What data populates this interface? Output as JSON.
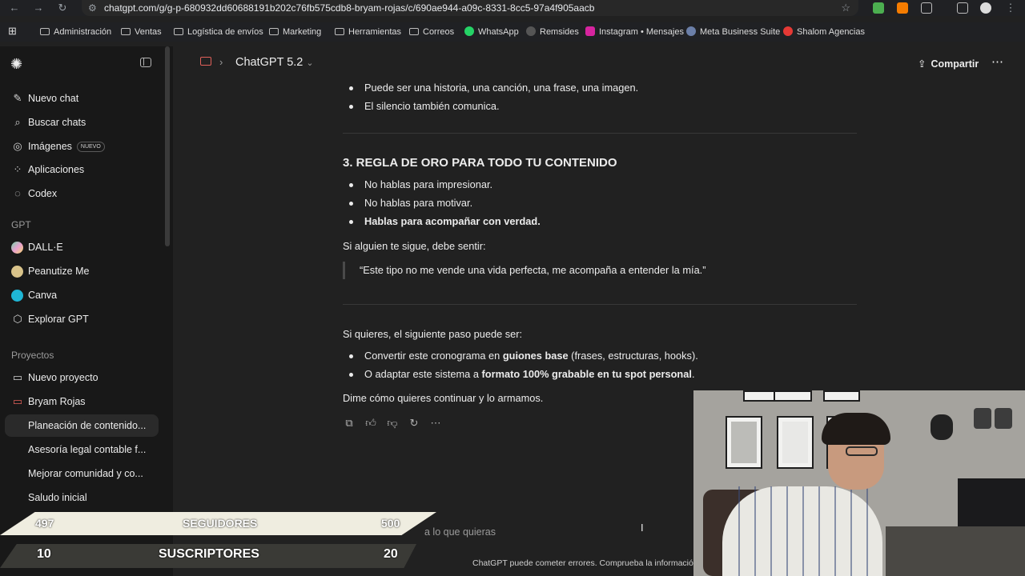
{
  "browser": {
    "url": "chatgpt.com/g/g-p-680932dd60688191b202c76fb575cdb8-bryam-rojas/c/690ae944-a09c-8331-8cc5-97a4f905aacb",
    "bookmarks": [
      {
        "label": "Administración",
        "icon": "folder-icon"
      },
      {
        "label": "Ventas",
        "icon": "folder-icon"
      },
      {
        "label": "Logística de envíos",
        "icon": "folder-icon"
      },
      {
        "label": "Marketing",
        "icon": "folder-icon"
      },
      {
        "label": "Herramientas",
        "icon": "folder-icon"
      },
      {
        "label": "Correos",
        "icon": "folder-icon"
      },
      {
        "label": "WhatsApp",
        "icon": "whatsapp-icon"
      },
      {
        "label": "Remsides",
        "icon": "remsides-icon"
      },
      {
        "label": "Instagram • Mensajes",
        "icon": "instagram-icon"
      },
      {
        "label": "Meta Business Suite",
        "icon": "meta-icon"
      },
      {
        "label": "Shalom Agencias",
        "icon": "shalom-icon"
      }
    ]
  },
  "sidebar": {
    "nav": [
      {
        "label": "Nuevo chat",
        "icon": "new-chat-icon"
      },
      {
        "label": "Buscar chats",
        "icon": "search-icon"
      },
      {
        "label": "Imágenes",
        "icon": "images-icon",
        "badge": "NUEVO"
      },
      {
        "label": "Aplicaciones",
        "icon": "apps-icon"
      },
      {
        "label": "Codex",
        "icon": "codex-icon"
      }
    ],
    "gpt_section": "GPT",
    "gpts": [
      {
        "label": "DALL·E",
        "color": "#6fd3a2"
      },
      {
        "label": "Peanutize Me",
        "color": "#d9c38a"
      },
      {
        "label": "Canva",
        "color": "#1fb6d6"
      },
      {
        "label": "Explorar GPT",
        "icon": "explore-icon"
      }
    ],
    "projects_section": "Proyectos",
    "projects": [
      {
        "label": "Nuevo proyecto",
        "icon": "new-project-icon"
      },
      {
        "label": "Bryam Rojas",
        "icon": "folder-icon"
      }
    ],
    "chats": [
      "Planeación de contenido...",
      "Asesoría legal contable f...",
      "Mejorar comunidad y co...",
      "Saludo inicial"
    ]
  },
  "header": {
    "model": "ChatGPT 5.2",
    "share": "Compartir"
  },
  "message": {
    "top_bullets": [
      "Puede ser una historia, una canción, una frase, una imagen.",
      "El silencio también comunica."
    ],
    "heading": "3. REGLA DE ORO PARA TODO TU CONTENIDO",
    "rule_bullets": [
      "No hablas para impresionar.",
      "No hablas para motivar.",
      "Hablas para acompañar con verdad."
    ],
    "follow_intro": "Si alguien te sigue, debe sentir:",
    "quote": "“Este tipo no me vende una vida perfecta, me acompaña a entender la mía.”",
    "next_intro": "Si quieres, el siguiente paso puede ser:",
    "next_1_pre": "Convertir este cronograma en ",
    "next_1_bold": "guiones base",
    "next_1_post": " (frases, estructuras, hooks).",
    "next_2_pre": "O adaptar este sistema a ",
    "next_2_bold": "formato 100% grabable en tu spot personal",
    "next_2_post": ".",
    "closing": "Dime cómo quieres continuar y lo armamos."
  },
  "composer": {
    "placeholder": "Pregunta lo que quieras",
    "visible_fragment": "a lo que quieras",
    "disclaimer": "ChatGPT puede cometer errores. Comprueba la información im"
  },
  "overlay": {
    "followers_label": "SEGUIDORES",
    "followers_current": "497",
    "followers_goal": "500",
    "subs_label": "SUSCRIPTORES",
    "subs_current": "10",
    "subs_goal": "20"
  }
}
